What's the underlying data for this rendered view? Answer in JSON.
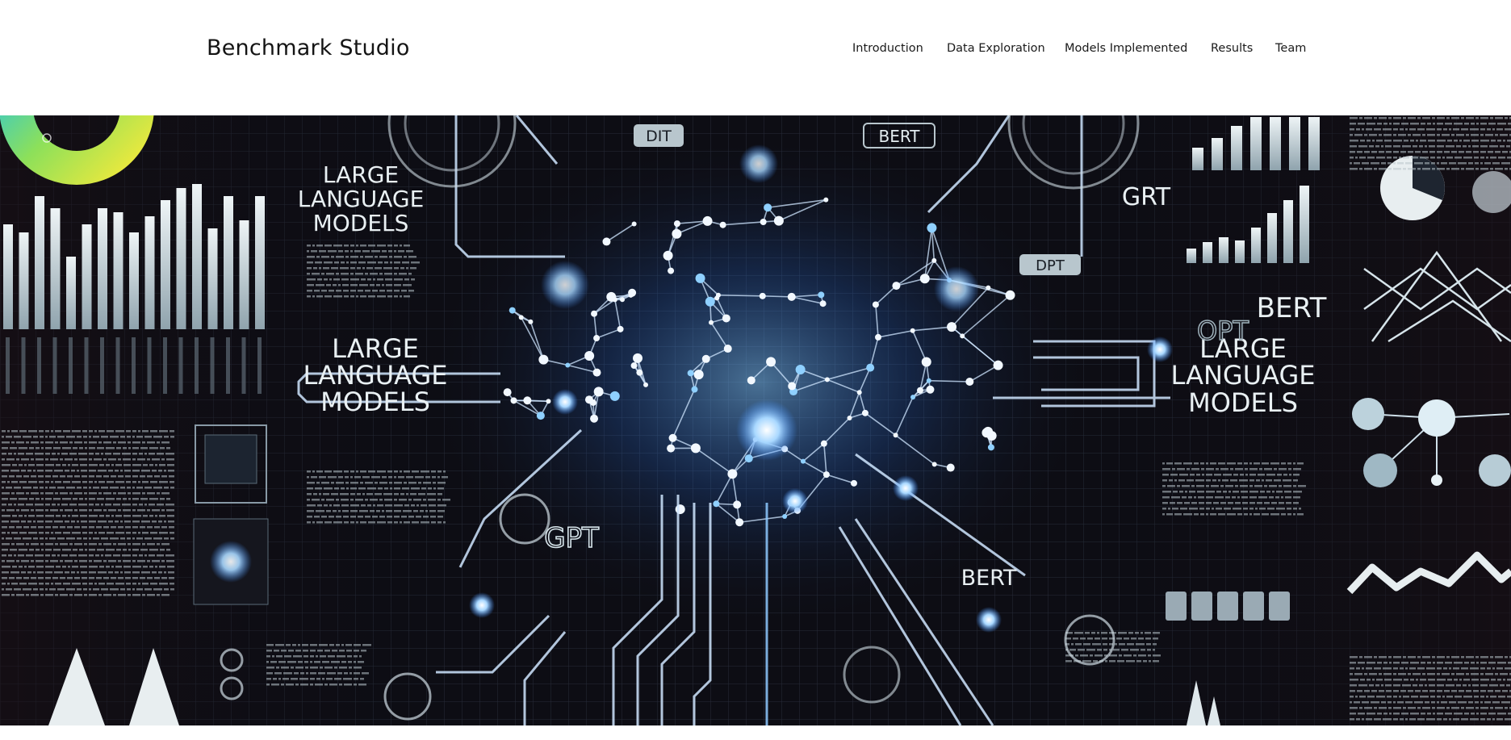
{
  "header": {
    "brand": "Benchmark Studio",
    "nav": [
      {
        "label": "Introduction"
      },
      {
        "label": "Data Exploration"
      },
      {
        "label": "Models Implemented"
      },
      {
        "label": "Results"
      },
      {
        "label": "Team"
      }
    ]
  },
  "hero": {
    "labels": {
      "llm_top_left": [
        "LARGE",
        "LANGUAGE",
        "MODELS"
      ],
      "llm_mid_left": [
        "LARGE",
        "LANGUAGE",
        "MODELS"
      ],
      "llm_mid_right": [
        "LARGE",
        "LANGUAGE",
        "MODELS"
      ],
      "dit": "DIT",
      "bert_top": "BERT",
      "grt": "GRT",
      "dpt": "DPT",
      "bert_right": "BERT",
      "opt": "OPT",
      "gpt": "GPT",
      "bert_bottom": "BERT"
    },
    "colors": {
      "background": "#0d0d14",
      "glow": "#6fb8ff",
      "grid": "#2a3240",
      "line": "#cfe6ff"
    }
  }
}
